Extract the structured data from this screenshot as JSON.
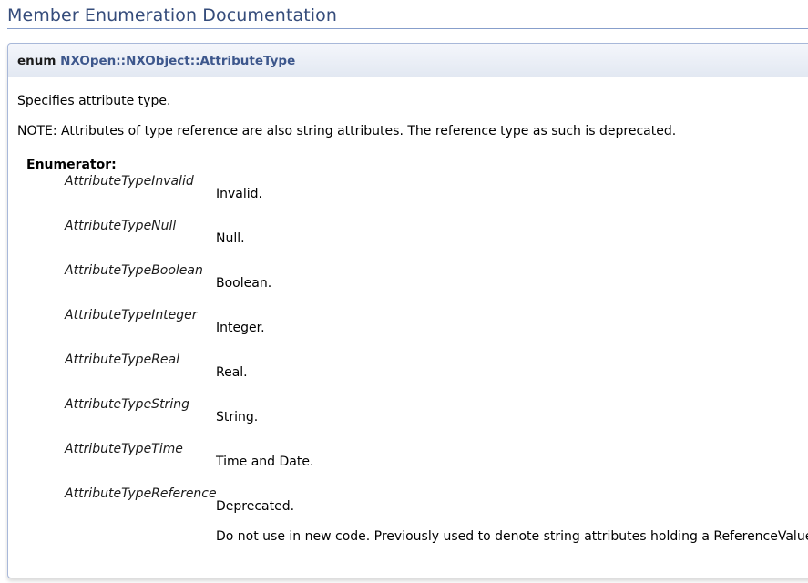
{
  "section_title": "Member Enumeration Documentation",
  "prototype": {
    "keyword": "enum",
    "name": "NXOpen::NXObject::AttributeType"
  },
  "doc": {
    "brief": "Specifies attribute type.",
    "note": "NOTE: Attributes of type reference are also string attributes. The reference type as such is deprecated.",
    "enumerator_heading": "Enumerator:",
    "enumerators": [
      {
        "name": "AttributeTypeInvalid",
        "description": "Invalid."
      },
      {
        "name": "AttributeTypeNull",
        "description": "Null."
      },
      {
        "name": "AttributeTypeBoolean",
        "description": "Boolean."
      },
      {
        "name": "AttributeTypeInteger",
        "description": "Integer."
      },
      {
        "name": "AttributeTypeReal",
        "description": "Real."
      },
      {
        "name": "AttributeTypeString",
        "description": "String."
      },
      {
        "name": "AttributeTypeTime",
        "description": "Time and Date."
      },
      {
        "name": "AttributeTypeReference",
        "description": "Deprecated.",
        "extra": "Do not use in new code. Previously used to denote string attributes holding a ReferenceValue"
      }
    ]
  }
}
